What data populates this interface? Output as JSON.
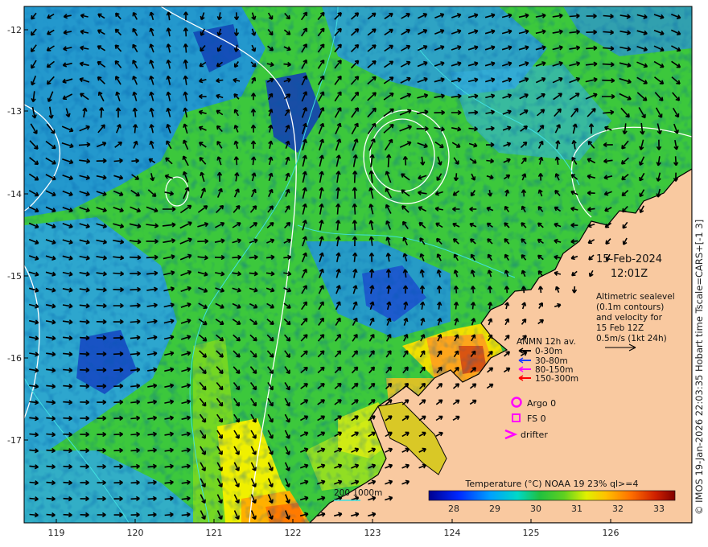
{
  "map": {
    "lon_ticks": [
      "119",
      "120",
      "121",
      "122",
      "123",
      "124",
      "125",
      "126"
    ],
    "lat_ticks": [
      "-12",
      "-13",
      "-14",
      "-15",
      "-16",
      "-17"
    ]
  },
  "annotation": {
    "date": "15-Feb-2024",
    "time": "12:01Z",
    "desc_lines": [
      "Altimetric sealevel",
      "(0.1m contours)",
      "and velocity for",
      "15 Feb 12Z",
      "0.5m/s (1kt 24h)"
    ]
  },
  "anmn_legend": {
    "title": "ANMN 12h av.",
    "items": [
      {
        "label": "0-30m",
        "color": "#000000"
      },
      {
        "label": "30-80m",
        "color": "#1e3cff"
      },
      {
        "label": "80-150m",
        "color": "#ff00ff"
      },
      {
        "label": "150-300m",
        "color": "#ff0000"
      }
    ]
  },
  "markers": {
    "argo": "Argo 0",
    "fs": "FS 0",
    "drifter": "drifter",
    "color": "#ff00ff"
  },
  "bathymetry_label": "200  1000m",
  "colorbar": {
    "title": "Temperature (°C) NOAA 19 23% ql>=4",
    "ticks": [
      "28",
      "29",
      "30",
      "31",
      "32",
      "33"
    ]
  },
  "credit": "© IMOS 19-Jan-2026 22:03:35 Hobart time Tscale=CARS+[-1 3]",
  "colors": {
    "land": "#f9c9a0",
    "coast": "#000000",
    "contour": "#ffffff",
    "isobath": "#40e0e0",
    "arrow": "#000000"
  }
}
